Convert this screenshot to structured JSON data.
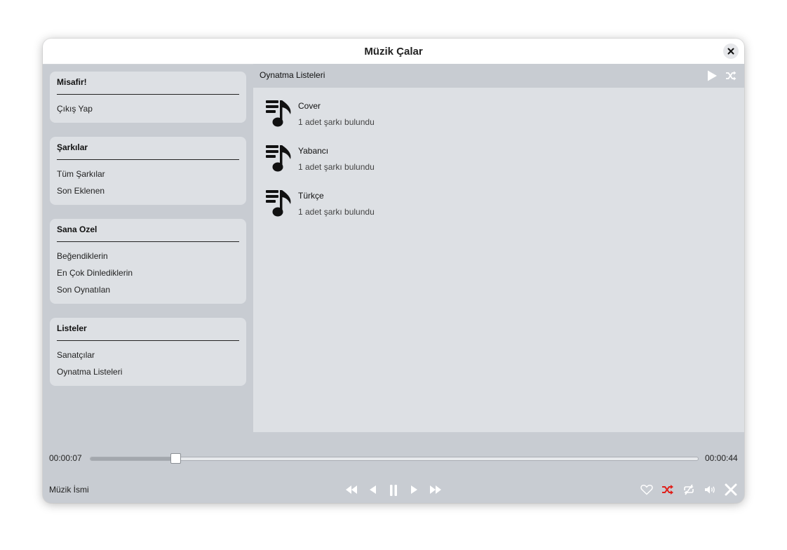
{
  "window": {
    "title": "Müzik Çalar"
  },
  "sidebar": {
    "sections": [
      {
        "title": "Misafir!",
        "items": [
          "Çıkış Yap"
        ]
      },
      {
        "title": "Şarkılar",
        "items": [
          "Tüm Şarkılar",
          "Son Eklenen"
        ]
      },
      {
        "title": "Sana Ozel",
        "items": [
          "Beğendiklerin",
          "En Çok Dinlediklerin",
          "Son Oynatılan"
        ]
      },
      {
        "title": "Listeler",
        "items": [
          "Sanatçılar",
          "Oynatma Listeleri"
        ]
      }
    ]
  },
  "main": {
    "header_title": "Oynatma Listeleri",
    "playlists": [
      {
        "name": "Cover",
        "count_text": "1 adet şarkı bulundu"
      },
      {
        "name": "Yabancı",
        "count_text": "1 adet şarkı bulundu"
      },
      {
        "name": "Türkçe",
        "count_text": "1 adet şarkı bulundu"
      }
    ]
  },
  "player": {
    "elapsed": "00:00:07",
    "total": "00:00:44",
    "progress_fraction": 0.14,
    "song_name": "Müzik İsmi",
    "shuffle_active": true,
    "shuffle_color": "#e0201b"
  },
  "icons": {
    "close": "close-icon",
    "play_all": "play-icon",
    "shuffle_all": "shuffle-icon",
    "playlist": "playlist-music-icon",
    "rewind": "rewind-icon",
    "previous": "previous-icon",
    "pause": "pause-icon",
    "next": "next-icon",
    "fast_forward": "fast-forward-icon",
    "like": "heart-icon",
    "shuffle": "shuffle-icon",
    "repeat": "repeat-off-icon",
    "volume": "volume-icon",
    "exit": "close-icon"
  }
}
